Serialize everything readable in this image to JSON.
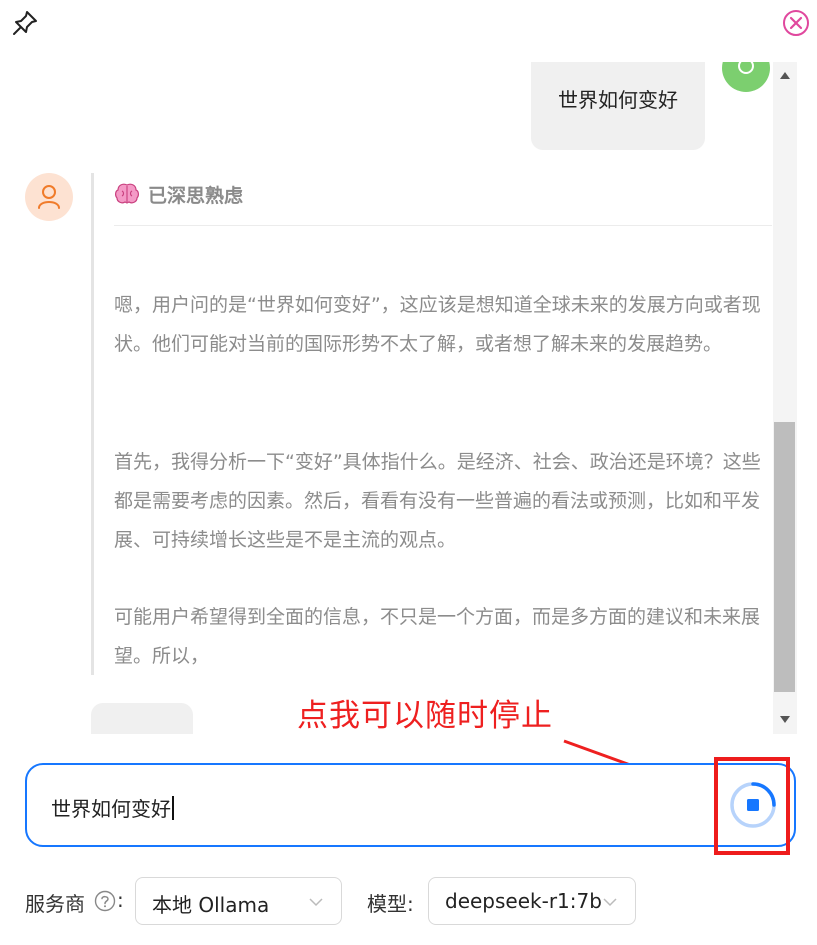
{
  "chat": {
    "user_message": "世界如何变好",
    "thinking_title": "已深思熟虑",
    "thinking_paragraphs": [
      "嗯，用户问的是“世界如何变好”，这应该是想知道全球未来的发展方向或者现状。他们可能对当前的国际形势不太了解，或者想了解未来的发展趋势。",
      "首先，我得分析一下“变好”具体指什么。是经济、社会、政治还是环境？这些都是需要考虑的因素。然后，看看有没有一些普遍的看法或预测，比如和平发展、可持续增长这些是不是主流的观点。",
      "可能用户希望得到全面的信息，不只是一个方面，而是多方面的建议和未来展望。所以，"
    ]
  },
  "annotation": {
    "text": "点我可以随时停止"
  },
  "input": {
    "value": "世界如何变好"
  },
  "footer": {
    "provider_label": "服务商",
    "colon": ":",
    "provider_value": "本地 Ollama",
    "model_label": "模型:",
    "model_value": "deepseek-r1:7b"
  },
  "icons": {
    "pin": "pin-icon",
    "close": "close-circle-icon",
    "brain": "brain-icon",
    "stop": "stop-icon",
    "help": "question-circle-icon",
    "chevron": "chevron-down-icon"
  },
  "colors": {
    "accent": "#1677ff",
    "close": "#e0489e",
    "annotation": "#ee2020",
    "user_avatar": "#7ccf6f",
    "bot_avatar": "#fde2d2"
  }
}
